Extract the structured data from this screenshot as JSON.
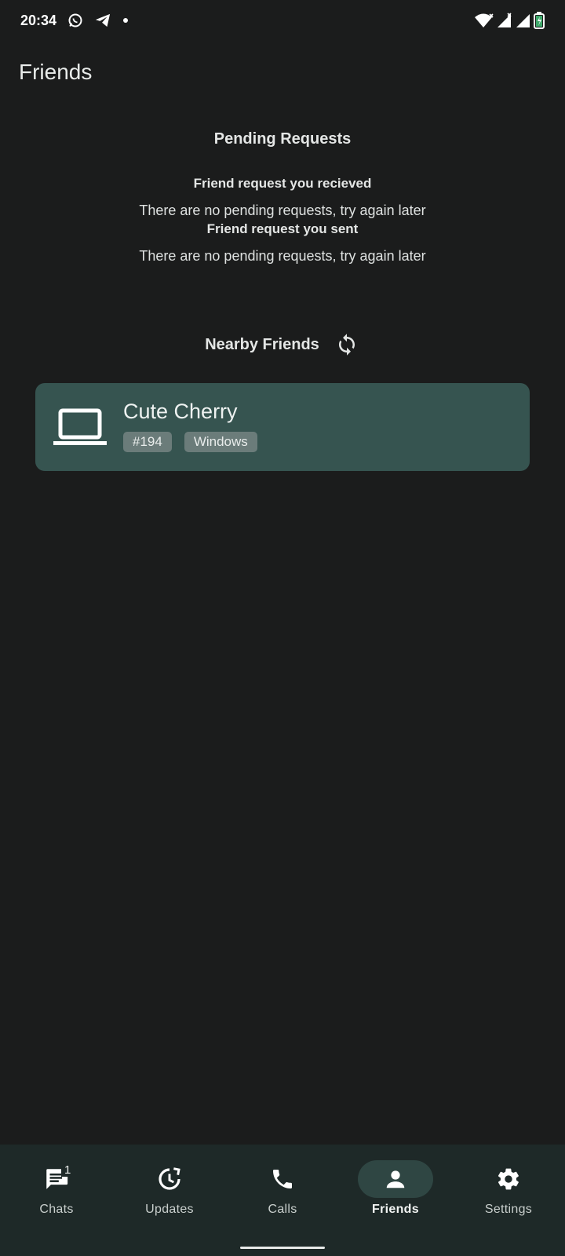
{
  "status_bar": {
    "time": "20:34",
    "icons": [
      "whatsapp-icon",
      "telegram-icon",
      "dot-icon",
      "wifi-icon",
      "signal-icon",
      "signal-icon",
      "battery-charging-icon"
    ]
  },
  "app_bar": {
    "title": "Friends"
  },
  "pending": {
    "title": "Pending Requests",
    "received_title": "Friend request you recieved",
    "received_empty": "There are no pending requests, try again later",
    "sent_title": "Friend request you sent",
    "sent_empty": "There are no pending requests, try again later"
  },
  "nearby": {
    "title": "Nearby Friends",
    "devices": [
      {
        "name": "Cute Cherry",
        "id_tag": "#194",
        "os_tag": "Windows",
        "icon": "laptop-icon"
      }
    ]
  },
  "bottom_nav": {
    "items": [
      {
        "label": "Chats",
        "icon": "chat-icon",
        "badge": "1"
      },
      {
        "label": "Updates",
        "icon": "updates-icon"
      },
      {
        "label": "Calls",
        "icon": "phone-icon"
      },
      {
        "label": "Friends",
        "icon": "person-icon",
        "active": true
      },
      {
        "label": "Settings",
        "icon": "gear-icon"
      }
    ]
  },
  "colors": {
    "background": "#1b1c1c",
    "card": "#365450",
    "tag": "#6b7c7a",
    "nav_background": "#1e2928",
    "nav_active": "#2f4643"
  }
}
